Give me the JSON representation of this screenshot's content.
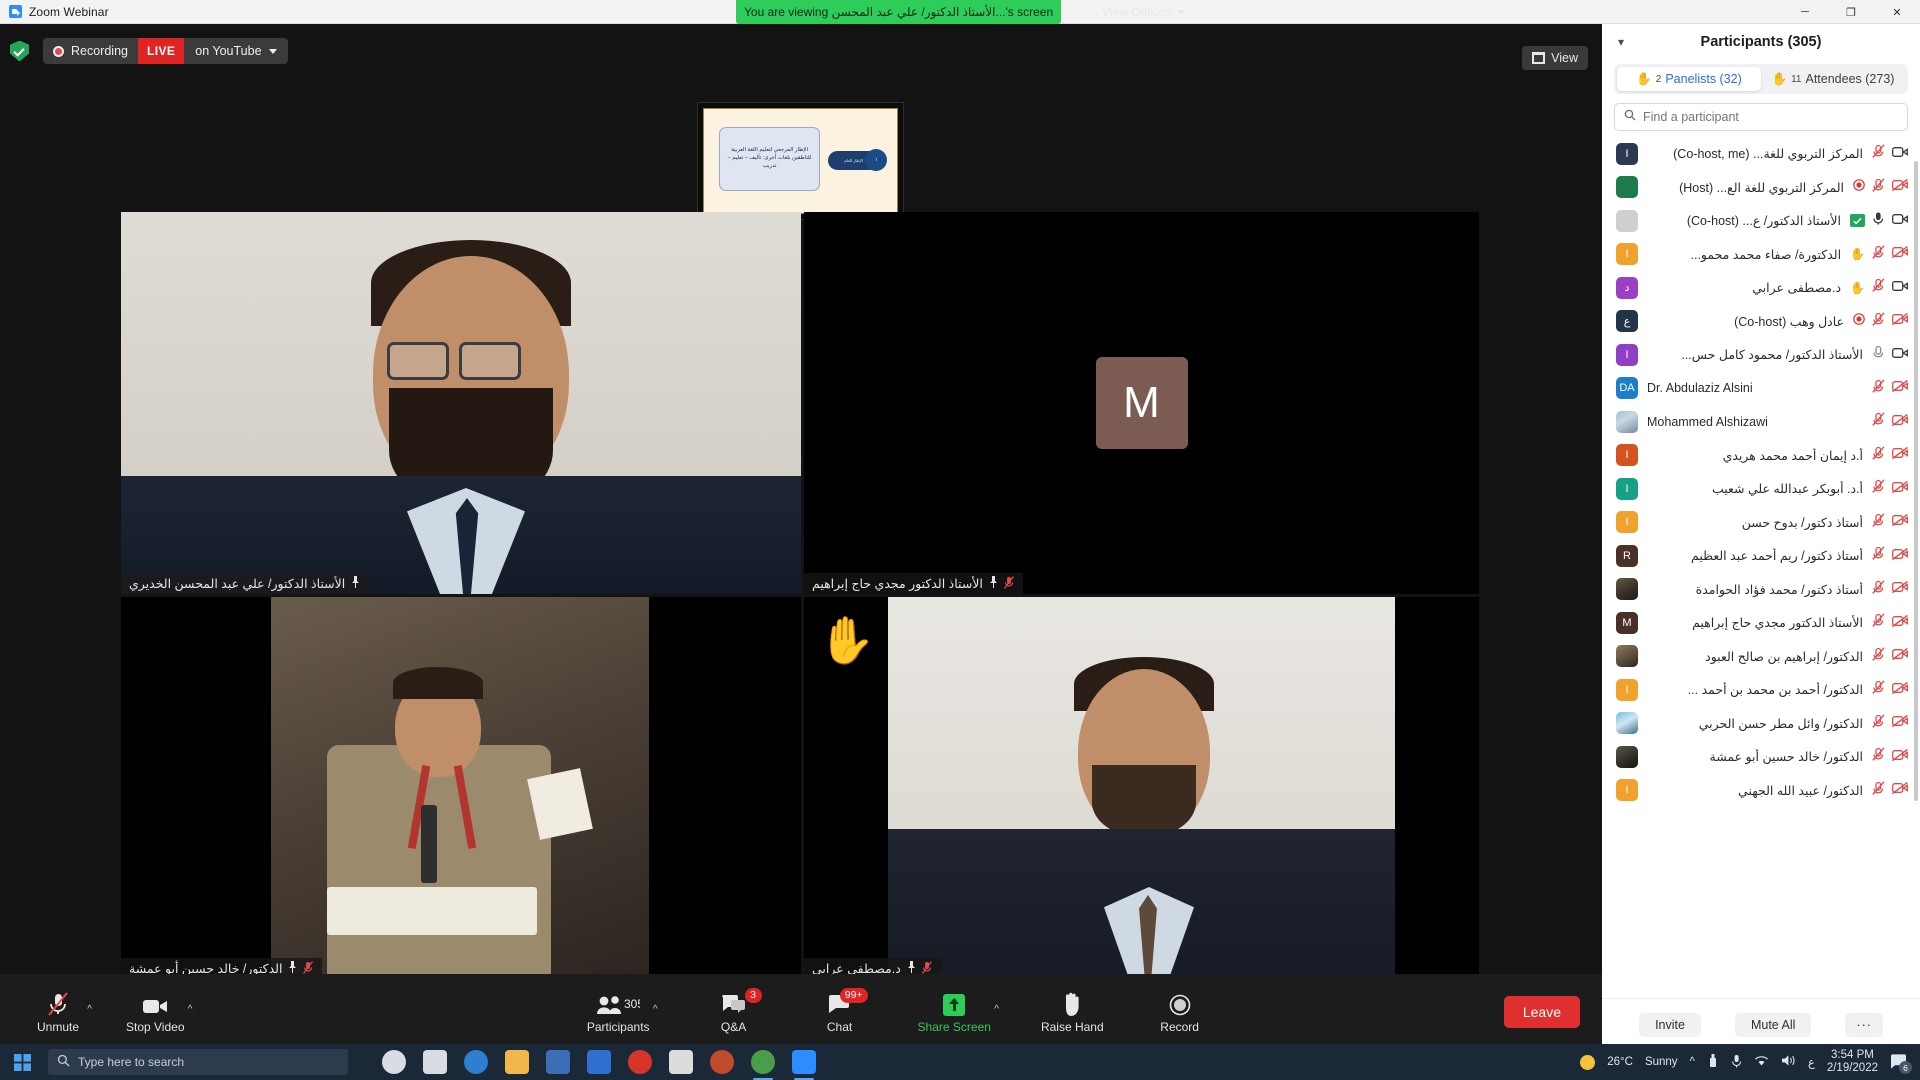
{
  "window": {
    "title": "Zoom Webinar",
    "app_icon": "zoom-icon",
    "minimize_glyph": "─",
    "maximize_glyph": "❐",
    "close_glyph": "✕"
  },
  "share_banner": {
    "text": "You are viewing الأستاذ الدكتور/ علي عبد المحسن...'s screen",
    "view_options_label": "View Options"
  },
  "recording_bar": {
    "shield_icon": "shield-check-icon",
    "recording_label": "Recording",
    "live_label": "LIVE",
    "platform_label": "on YouTube",
    "view_label": "View"
  },
  "shared_slide": {
    "box_text": "الإطار المرجعي لتعليم اللغة العربية للناطقين بلغات أخرى: تأليف – تعليم – تدريب",
    "pill_text": "الإطار العام",
    "circle_text": "١"
  },
  "video_tiles": [
    {
      "name": "الأستاذ الدكتور/ علي عبد المحسن الخديري",
      "active_speaker": true,
      "muted": false,
      "pinned": true,
      "kind": "speaker"
    },
    {
      "name": "الأستاذ الدكتور مجدي حاج إبراهيم",
      "active_speaker": false,
      "muted": true,
      "pinned": true,
      "kind": "initial",
      "initial": "M"
    },
    {
      "name": "الدكتور/ خالد حسين أبو عمشة",
      "active_speaker": false,
      "muted": true,
      "pinned": true,
      "kind": "room"
    },
    {
      "name": "د.مصطفى عرابي",
      "active_speaker": false,
      "muted": true,
      "pinned": true,
      "kind": "portrait",
      "hand_raised": true,
      "hand_emoji": "✋"
    }
  ],
  "toolbar": {
    "items": [
      {
        "label": "Unmute",
        "icon": "mic-muted-icon",
        "has_caret": true,
        "badge": null,
        "highlight": false
      },
      {
        "label": "Stop Video",
        "icon": "video-icon",
        "has_caret": true,
        "badge": null,
        "highlight": false
      },
      {
        "label": "Participants",
        "icon": "participants-icon",
        "count": "305",
        "has_caret": true,
        "badge": null,
        "highlight": false
      },
      {
        "label": "Q&A",
        "icon": "qa-icon",
        "has_caret": false,
        "badge": "3",
        "highlight": false
      },
      {
        "label": "Chat",
        "icon": "chat-icon",
        "has_caret": false,
        "badge": "99+",
        "highlight": false
      },
      {
        "label": "Share Screen",
        "icon": "share-screen-icon",
        "has_caret": true,
        "badge": null,
        "highlight": true
      },
      {
        "label": "Raise Hand",
        "icon": "raise-hand-icon",
        "has_caret": false,
        "badge": null,
        "highlight": false
      },
      {
        "label": "Record",
        "icon": "record-icon",
        "has_caret": false,
        "badge": null,
        "highlight": false
      }
    ],
    "leave_label": "Leave"
  },
  "participants_panel": {
    "title": "Participants (305)",
    "collapse_icon": "chevron-down-icon",
    "tabs": [
      {
        "label": "Panelists (32)",
        "hand_count": "2",
        "active": true
      },
      {
        "label": "Attendees (273)",
        "hand_count": "11",
        "active": false
      }
    ],
    "search_placeholder": "Find a participant",
    "search_value": "",
    "search_icon": "search-icon",
    "footer": {
      "invite_label": "Invite",
      "mute_all_label": "Mute All",
      "more_label": "···"
    },
    "rows": [
      {
        "name": "المركز التربوي للغة...",
        "role": "(Co-host, me)",
        "initial": "I",
        "color": "#2b3a52",
        "rtl": true,
        "mic": "muted",
        "video": "on",
        "record": false,
        "hand": false
      },
      {
        "name": "المركز التربوي للغة الع...",
        "role": "(Host)",
        "initial": "",
        "color": "#1e7a48",
        "rtl": true,
        "mic": "muted",
        "video": "off",
        "record": true,
        "hand": false
      },
      {
        "name": "الأستاذ الدكتور/ ع...",
        "role": "(Co-host)",
        "initial": "",
        "color": "#cfcfcf",
        "rtl": true,
        "mic": "on",
        "video": "on",
        "record": false,
        "hand": false,
        "green_badge": true
      },
      {
        "name": "الدكتورة/ صفاء محمد محمو...",
        "role": "",
        "initial": "I",
        "color": "#f0a12e",
        "rtl": true,
        "mic": "muted",
        "video": "off",
        "record": false,
        "hand": true
      },
      {
        "name": "د.مصطفى عرابي",
        "role": "",
        "initial": "د",
        "color": "#9b3fc4",
        "rtl": true,
        "mic": "muted",
        "video": "on",
        "record": false,
        "hand": true
      },
      {
        "name": "عادل وهب",
        "role": "(Co-host)",
        "initial": "ع",
        "color": "#223448",
        "rtl": true,
        "mic": "muted",
        "video": "off",
        "record": true,
        "hand": false
      },
      {
        "name": "الأستاذ الدكتور/ محمود كامل حس...",
        "role": "",
        "initial": "I",
        "color": "#8f3fc4",
        "rtl": true,
        "mic": "low",
        "video": "on",
        "record": false,
        "hand": false
      },
      {
        "name": "Dr. Abdulaziz Alsini",
        "role": "",
        "initial": "DA",
        "color": "#1d7fc9",
        "rtl": false,
        "mic": "muted",
        "video": "off",
        "record": false,
        "hand": false
      },
      {
        "name": "Mohammed Alshizawi",
        "role": "",
        "initial": "",
        "color": "#8fb6d6",
        "rtl": false,
        "mic": "muted",
        "video": "off",
        "record": false,
        "hand": false,
        "photo": "portrait-a"
      },
      {
        "name": "أ.د إيمان أحمد محمد هريدي",
        "role": "",
        "initial": "I",
        "color": "#d2541f",
        "rtl": true,
        "mic": "muted",
        "video": "off",
        "record": false,
        "hand": false
      },
      {
        "name": "أ.د. أبوبكر عبدالله علي شعيب",
        "role": "",
        "initial": "I",
        "color": "#16a085",
        "rtl": true,
        "mic": "muted",
        "video": "off",
        "record": false,
        "hand": false
      },
      {
        "name": "أستاذ دكتور/ بدوح حسن",
        "role": "",
        "initial": "I",
        "color": "#f0a12e",
        "rtl": true,
        "mic": "muted",
        "video": "off",
        "record": false,
        "hand": false
      },
      {
        "name": "أستاذ دكتور/ ريم أحمد عبد العظيم",
        "role": "",
        "initial": "R",
        "color": "#4a3027",
        "rtl": true,
        "mic": "muted",
        "video": "off",
        "record": false,
        "hand": false
      },
      {
        "name": "أستاذ دكتور/ محمد فؤاد الحوامدة",
        "role": "",
        "initial": "",
        "color": "#4c4137",
        "rtl": true,
        "mic": "muted",
        "video": "off",
        "record": false,
        "hand": false,
        "photo": "portrait-b"
      },
      {
        "name": "الأستاذ الدكتور مجدي حاج إبراهيم",
        "role": "",
        "initial": "M",
        "color": "#4a3027",
        "rtl": true,
        "mic": "muted",
        "video": "off",
        "record": false,
        "hand": false
      },
      {
        "name": "الدكتور/ إبراهيم بن صالح العبود",
        "role": "",
        "initial": "",
        "color": "#6b5640",
        "rtl": true,
        "mic": "muted",
        "video": "off",
        "record": false,
        "hand": false,
        "photo": "portrait-c"
      },
      {
        "name": "الدكتور/ أحمد بن محمد بن أحمد ...",
        "role": "",
        "initial": "I",
        "color": "#f0a12e",
        "rtl": true,
        "mic": "muted",
        "video": "off",
        "record": false,
        "hand": false
      },
      {
        "name": "الدكتور/ وائل مطر حسن الحربي",
        "role": "",
        "initial": "",
        "color": "#49a0d8",
        "rtl": true,
        "mic": "muted",
        "video": "off",
        "record": false,
        "hand": false,
        "photo": "portrait-d"
      },
      {
        "name": "الدكتور/ خالد حسين أبو عمشة",
        "role": "",
        "initial": "",
        "color": "#3d3a33",
        "rtl": true,
        "mic": "muted",
        "video": "off",
        "record": false,
        "hand": false,
        "photo": "portrait-e"
      },
      {
        "name": "الدكتور/ عبيد الله الجهني",
        "role": "",
        "initial": "I",
        "color": "#f0a12e",
        "rtl": true,
        "mic": "muted",
        "video": "off",
        "record": false,
        "hand": false
      }
    ]
  },
  "taskbar": {
    "search_placeholder": "Type here to search",
    "start_icon": "windows-start-icon",
    "search_icon": "search-icon",
    "apps": [
      {
        "icon": "cortana-icon",
        "color": "#d8dde3",
        "active": false
      },
      {
        "icon": "task-view-icon",
        "color": "#d8dde3",
        "active": false
      },
      {
        "icon": "edge-icon",
        "color": "#2f7fd1",
        "active": false
      },
      {
        "icon": "file-explorer-icon",
        "color": "#f1b64c",
        "active": false
      },
      {
        "icon": "store-icon",
        "color": "#3b6fb5",
        "active": false
      },
      {
        "icon": "dropbox-icon",
        "color": "#2f6fd0",
        "active": false
      },
      {
        "icon": "opera-icon",
        "color": "#d8352a",
        "active": false
      },
      {
        "icon": "notepad-icon",
        "color": "#dcdcdc",
        "active": false
      },
      {
        "icon": "media-player-icon",
        "color": "#c04a2a",
        "active": false
      },
      {
        "icon": "chrome-icon",
        "color": "#4a9e4a",
        "active": true
      },
      {
        "icon": "zoom-icon",
        "color": "#2d8cff",
        "active": true
      }
    ],
    "weather": {
      "temperature": "26°C",
      "condition": "Sunny",
      "icon": "sun-icon"
    },
    "tray_icons": [
      "chevron-up-icon",
      "usb-icon",
      "microphone-icon",
      "wifi-icon",
      "volume-icon"
    ],
    "language": "ع",
    "clock": {
      "time": "3:54 PM",
      "date": "2/19/2022"
    },
    "notification_count": "6"
  }
}
